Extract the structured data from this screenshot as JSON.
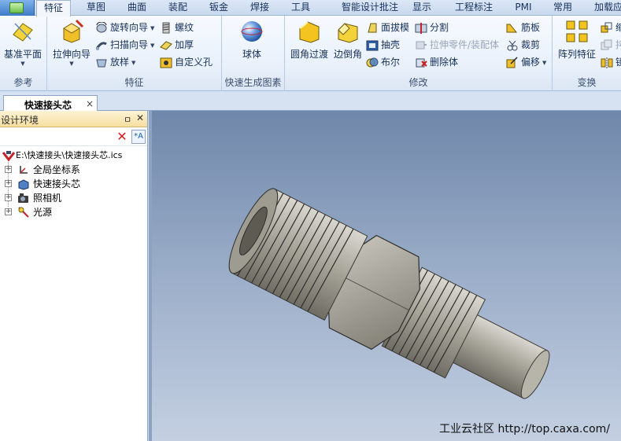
{
  "ribbon_tabs": [
    {
      "label": "特征",
      "active": true
    },
    {
      "label": "草图"
    },
    {
      "label": "曲面"
    },
    {
      "label": "装配"
    },
    {
      "label": "钣金"
    },
    {
      "label": "焊接"
    },
    {
      "label": "工具"
    },
    {
      "label": "智能设计批注"
    },
    {
      "label": "显示"
    },
    {
      "label": "工程标注"
    },
    {
      "label": "PMI"
    },
    {
      "label": "常用"
    },
    {
      "label": "加载应"
    }
  ],
  "groups": {
    "reference": {
      "label": "参考",
      "datum_plane": "基准平面"
    },
    "feature": {
      "label": "特征",
      "extrude_wizard": "拉伸向导",
      "revolve_wizard": "旋转向导",
      "sweep_wizard": "扫描向导",
      "loft": "放样",
      "thread": "螺纹",
      "thicken": "加厚",
      "custom_hole": "自定义孔"
    },
    "quick_primitive": {
      "label": "快速生成图素",
      "sphere": "球体"
    },
    "modify": {
      "label": "修改",
      "fillet": "圆角过渡",
      "chamfer": "边倒角",
      "draft": "面拔模",
      "shell": "抽壳",
      "boolean": "布尔",
      "split": "分割",
      "stretch_part": "拉伸零件/装配体",
      "delete_body": "删除体",
      "rib": "筋板",
      "trim": "裁剪",
      "offset": "偏移"
    },
    "transform": {
      "label": "变换",
      "array_feature": "阵列特征",
      "scale_partial": "缩",
      "copy_partial": "拷",
      "mirror_partial": "镜"
    }
  },
  "document_tab": {
    "title": "快速接头芯",
    "close": "×"
  },
  "design_panel": {
    "title": "设计环境",
    "pin": "ㅁ",
    "close": "✕",
    "tree": {
      "root": "E:\\快速接头\\快速接头芯.ics",
      "items": [
        "全局坐标系",
        "快速接头芯",
        "照相机",
        "光源"
      ]
    }
  },
  "viewport": {
    "watermark": "工业云社区 http://top.caxa.com/"
  },
  "colors": {
    "accent": "#3f7cc8",
    "ribbon_bg": "#e8f0fa",
    "panel_header": "#f5dfa0",
    "viewport_top": "#6f87aa",
    "viewport_bottom": "#c4d0e2"
  }
}
